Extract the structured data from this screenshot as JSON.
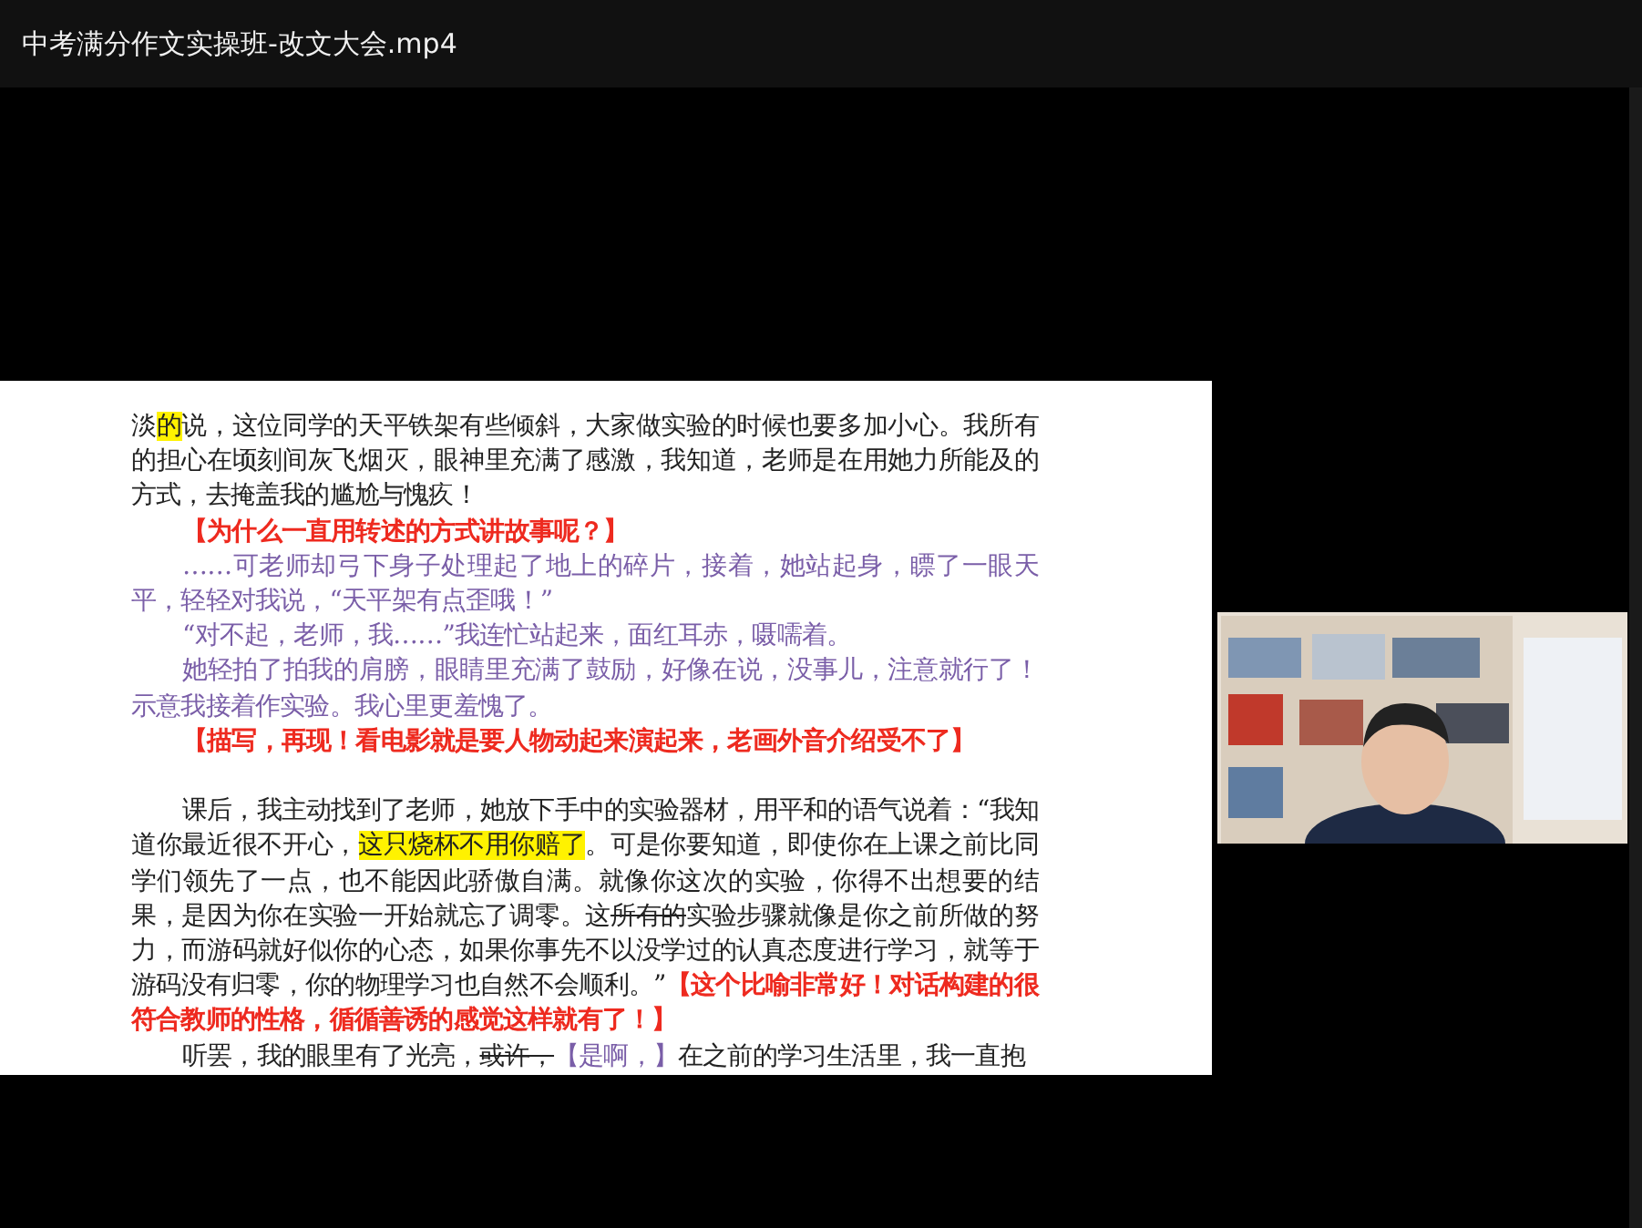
{
  "window": {
    "title": "中考满分作文实操班-改文大会.mp4"
  },
  "document": {
    "paragraphs": [
      {
        "indent": false,
        "space_before": false,
        "runs": [
          {
            "kind": "text",
            "text": "淡"
          },
          {
            "kind": "highlight",
            "text": "的"
          },
          {
            "kind": "text",
            "text": "说，这位同学的天平铁架有些倾斜，大家做实验的时候也要多加小心。我所有的担心在顷刻间灰飞烟灭，眼神里充满了感激，我知道，老师是在用她力所能及的方式，去掩盖我的尴尬与愧疚！"
          }
        ]
      },
      {
        "indent": true,
        "space_before": false,
        "runs": [
          {
            "kind": "comment",
            "text": "【为什么一直用转述的方式讲故事呢？】"
          }
        ]
      },
      {
        "indent": true,
        "space_before": false,
        "runs": [
          {
            "kind": "revision",
            "text": "……可老师却弓下身子处理起了地上的碎片，接着，她站起身，瞟了一眼天平，轻轻对我说，“天平架有点歪哦！”"
          }
        ]
      },
      {
        "indent": true,
        "space_before": false,
        "runs": [
          {
            "kind": "revision",
            "text": "“对不起，老师，我……”我连忙站起来，面红耳赤，嗫嚅着。"
          }
        ]
      },
      {
        "indent": true,
        "space_before": false,
        "runs": [
          {
            "kind": "revision",
            "text": "她轻拍了拍我的肩膀，眼睛里充满了鼓励，好像在说，没事儿，注意就行了！示意我接着作实验。我心里更羞愧了。"
          }
        ]
      },
      {
        "indent": true,
        "space_before": false,
        "runs": [
          {
            "kind": "comment",
            "text": "【描写，再现！看电影就是要人物动起来演起来，老画外音介绍受不了】"
          }
        ]
      },
      {
        "indent": true,
        "space_before": true,
        "runs": [
          {
            "kind": "text",
            "text": "课后，我主动找到了老师，她放下手中的实验器材，用平和的语气说着：“我知道你最近很不开心，"
          },
          {
            "kind": "highlight",
            "text": "这只烧杯不用你赔了"
          },
          {
            "kind": "text",
            "text": "。可是你要知道，即使你在上课之前比同学们领先了一点，也不能因此骄傲自满。就像你这次的实验，你得不出想要的结果，是因为你在实验一开始就忘了调零。这"
          },
          {
            "kind": "strike",
            "text": "所有的"
          },
          {
            "kind": "text",
            "text": "实验步骤就像是你之前所做的努力，而游码就好似你的心态，如果你事先不以没学过的认真态度进行学习，就等于游码没有归零，你的物理学习也自然不会顺利。”"
          },
          {
            "kind": "comment",
            "text": "【这个比喻非常好！对话构建的很符合教师的性格，循循善诱的感觉这样就有了！】"
          }
        ]
      },
      {
        "indent": true,
        "space_before": false,
        "runs": [
          {
            "kind": "text",
            "text": "听罢，我的眼里有了光亮，"
          },
          {
            "kind": "strike",
            "text": "或许，"
          },
          {
            "kind": "revision",
            "text": "【是啊，】"
          },
          {
            "kind": "text",
            "text": "在之前的学习生活里，我一直抱"
          }
        ]
      }
    ]
  }
}
